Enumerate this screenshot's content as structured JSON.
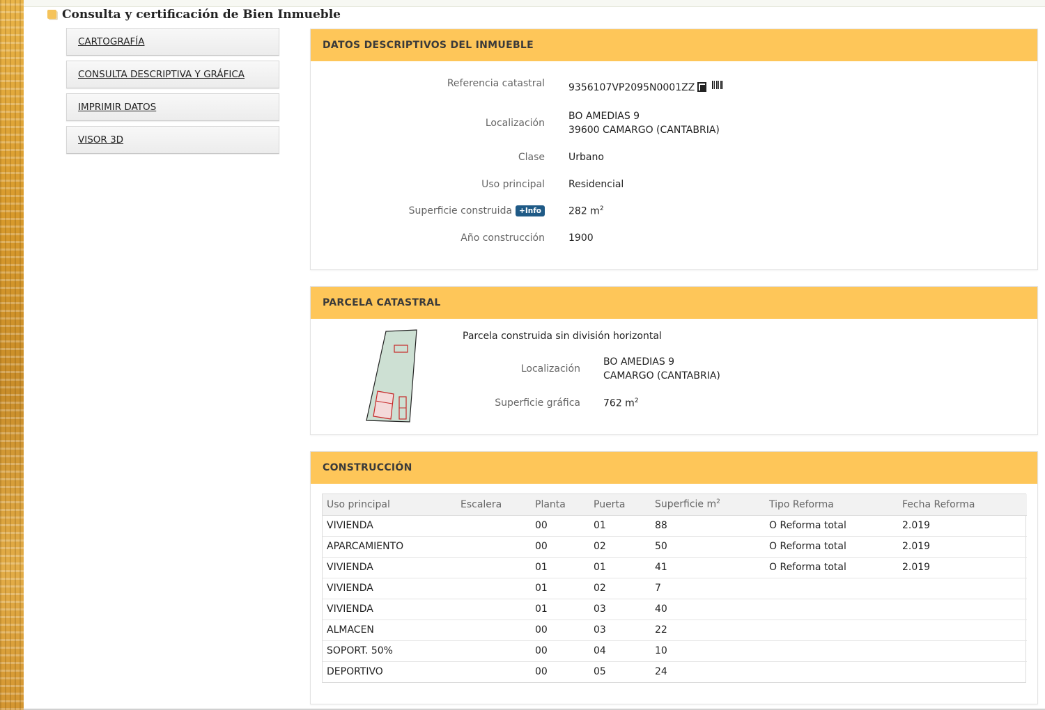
{
  "page": {
    "title": "Consulta y certificación de Bien Inmueble"
  },
  "menu": {
    "items": [
      {
        "label": "CARTOGRAFÍA"
      },
      {
        "label": "CONSULTA DESCRIPTIVA Y GRÁFICA"
      },
      {
        "label": "IMPRIMIR DATOS"
      },
      {
        "label": "VISOR 3D"
      }
    ]
  },
  "descriptivos": {
    "heading": "DATOS DESCRIPTIVOS DEL INMUEBLE",
    "ref_label": "Referencia catastral",
    "ref_value": "9356107VP2095N0001ZZ",
    "loc_label": "Localización",
    "loc_line1": "BO AMEDIAS 9",
    "loc_line2": "39600 CAMARGO (CANTABRIA)",
    "clase_label": "Clase",
    "clase_value": "Urbano",
    "uso_label": "Uso principal",
    "uso_value": "Residencial",
    "sup_label": "Superficie construida",
    "info_badge": "+Info",
    "sup_value": "282 m",
    "sup_unit_exp": "2",
    "anio_label": "Año construcción",
    "anio_value": "1900"
  },
  "parcela": {
    "heading": "PARCELA CATASTRAL",
    "description": "Parcela construida sin división horizontal",
    "loc_label": "Localización",
    "loc_line1": "BO AMEDIAS 9",
    "loc_line2": "CAMARGO (CANTABRIA)",
    "sup_label": "Superficie gráfica",
    "sup_value": "762 m",
    "sup_unit_exp": "2"
  },
  "construccion": {
    "heading": "CONSTRUCCIÓN",
    "columns": [
      "Uso principal",
      "Escalera",
      "Planta",
      "Puerta",
      "Superficie m",
      "Tipo Reforma",
      "Fecha Reforma"
    ],
    "surface_col_exp": "2",
    "rows": [
      [
        "VIVIENDA",
        "",
        "00",
        "01",
        "88",
        "O Reforma total",
        "2.019"
      ],
      [
        "APARCAMIENTO",
        "",
        "00",
        "02",
        "50",
        "O Reforma total",
        "2.019"
      ],
      [
        "VIVIENDA",
        "",
        "01",
        "01",
        "41",
        "O Reforma total",
        "2.019"
      ],
      [
        "VIVIENDA",
        "",
        "01",
        "02",
        "7",
        "",
        ""
      ],
      [
        "VIVIENDA",
        "",
        "01",
        "03",
        "40",
        "",
        ""
      ],
      [
        "ALMACEN",
        "",
        "00",
        "03",
        "22",
        "",
        ""
      ],
      [
        "SOPORT. 50%",
        "",
        "00",
        "04",
        "10",
        "",
        ""
      ],
      [
        "DEPORTIVO",
        "",
        "00",
        "05",
        "24",
        "",
        ""
      ]
    ]
  },
  "colors": {
    "panel_header": "#fec659",
    "badge": "#1f5a86",
    "parcel_fill": "#cde0d3",
    "building_outline": "#c62828"
  },
  "icons": {
    "copy": "copy-icon",
    "barcode": "barcode-icon",
    "title_marker": "square-marker-icon"
  }
}
